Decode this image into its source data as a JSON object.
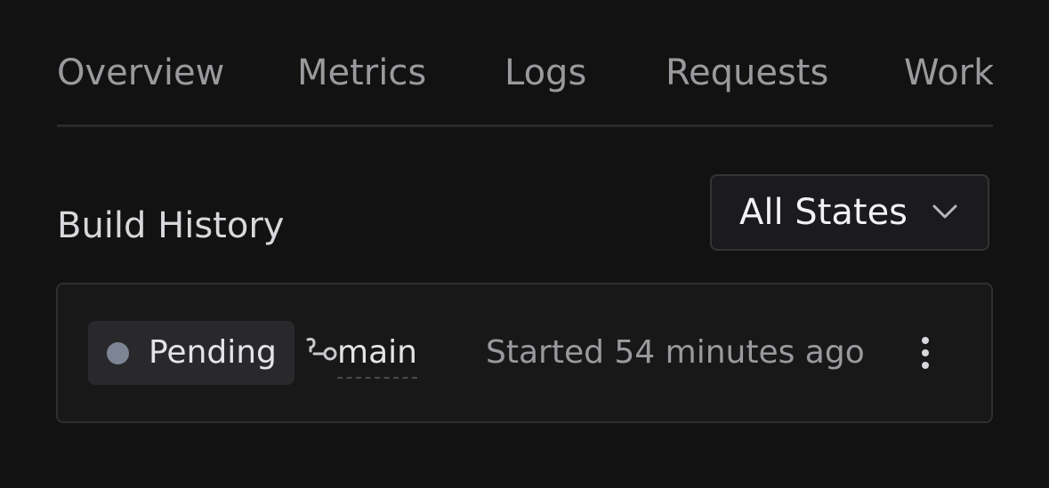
{
  "tabs": [
    {
      "label": "Overview"
    },
    {
      "label": "Metrics"
    },
    {
      "label": "Logs"
    },
    {
      "label": "Requests"
    },
    {
      "label": "Work"
    }
  ],
  "build_history": {
    "title": "Build History",
    "filter": {
      "selected": "All States",
      "icon": "chevron-down-icon"
    },
    "builds": [
      {
        "status": "Pending",
        "status_color": "#7d8595",
        "branch": "main",
        "branch_icon": "git-branch-icon",
        "started": "Started 54 minutes ago",
        "menu_icon": "more-vertical-icon"
      }
    ]
  },
  "colors": {
    "background": "#121212",
    "card": "#181819",
    "muted_text": "#9a9a9e",
    "primary_text": "#e4e4e6"
  }
}
